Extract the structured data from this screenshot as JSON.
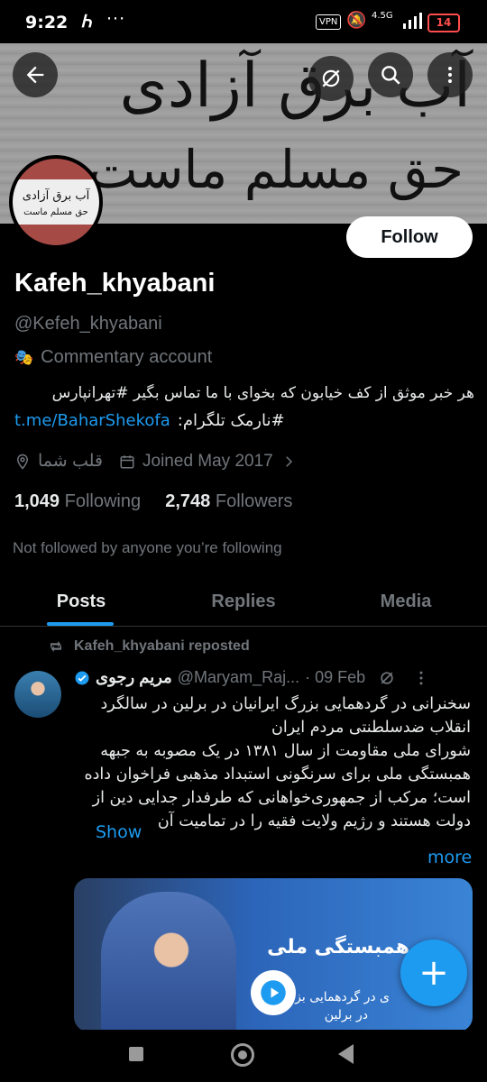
{
  "status_bar": {
    "time": "9:22",
    "n_icon": "Ꮒ",
    "dots": "···",
    "vpn": "VPN",
    "signal_label": "4.5G",
    "battery": "14"
  },
  "banner": {
    "line1": "آب برق آزادی",
    "line2": "حق مسلم ماست"
  },
  "avatar": {
    "line1": "آب برق آزادی",
    "line2": "حق مسلم ماست"
  },
  "profile": {
    "follow_label": "Follow",
    "name": "Kafeh_khyabani",
    "handle": "@Kefeh_khyabani",
    "account_type": "Commentary account",
    "bio_line1": "هر خبر موثق از کف خیابون که بخوای با ما تماس بگیر #تهرانپارس",
    "bio_line2_text": "#نارمک تلگرام:",
    "bio_link": "t.me/BaharShekofa",
    "location": "قلب شما",
    "joined": "Joined May 2017",
    "following_count": "1,049",
    "following_label": "Following",
    "followers_count": "2,748",
    "followers_label": "Followers",
    "not_followed": "Not followed by anyone you’re following"
  },
  "tabs": [
    {
      "label": "Posts"
    },
    {
      "label": "Replies"
    },
    {
      "label": "Media"
    }
  ],
  "post": {
    "repost_label": "Kafeh_khyabani reposted",
    "display_name": "مریم رجوی",
    "username": "@Maryam_Raj...",
    "date": "· 09 Feb",
    "body": "سخنرانی در گردهمایی بزرگ ایرانیان در برلین در سالگرد انقلاب ضدسلطنتی مردم ایران\nشورای ملی مقاومت از سال ۱۳۸۱ در یک مصوبه به جبهه همبستگی ملی برای سرنگونی استبداد مذهبی فراخوان داده است؛ مرکب از جمهوری‌خواهانی که طرفدار جدایی دین از دولت هستند و رژیم ولایت فقیه را در تمامیت آن",
    "show_label": "Show",
    "more_label": "more",
    "media_title": "همبستگی ملی",
    "media_line2": "ی در گردهمایی بزرگ ایر",
    "media_line3": "در برلین"
  },
  "fab_label": "+",
  "colors": {
    "accent": "#1d9bf0",
    "background": "#000000",
    "muted": "#71767b",
    "text": "#e7e9ea"
  }
}
